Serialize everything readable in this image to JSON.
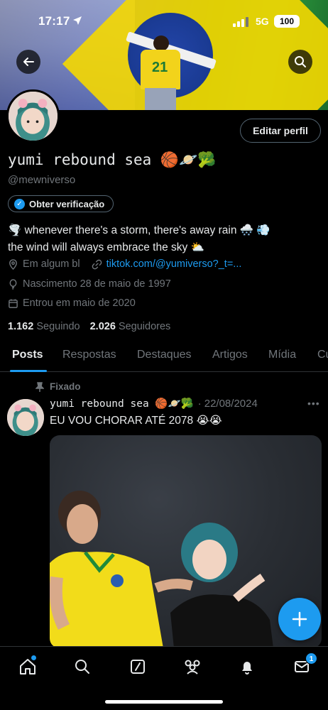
{
  "status_bar": {
    "time": "17:17",
    "network": "5G",
    "battery": "100"
  },
  "profile": {
    "name": "yumi rebound sea 🏀🪐🥦",
    "handle": "@mewniverso",
    "edit_label": "Editar perfil",
    "verify_label": "Obter verificação",
    "bio_line1": "🌪️ whenever there's a storm, there's away rain 🌨️ 💨",
    "bio_line2": "the wind will always embrace the sky ⛅",
    "location": "Em algum bl",
    "link": "tiktok.com/@yumiverso?_t=...",
    "birth": "Nascimento 28 de maio de 1997",
    "joined": "Entrou em maio de 2020",
    "following_count": "1.162",
    "following_label": "Seguindo",
    "followers_count": "2.026",
    "followers_label": "Seguidores"
  },
  "tabs": [
    "Posts",
    "Respostas",
    "Destaques",
    "Artigos",
    "Mídia",
    "Cu"
  ],
  "post": {
    "pinned_label": "Fixado",
    "author": "yumi rebound sea 🏀🪐🥦",
    "date": "· 22/08/2024",
    "text": "EU VOU CHORAR ATÉ 2078 😭😭"
  },
  "banner": {
    "shirt_number": "21"
  },
  "nav": {
    "notification_count": "1"
  },
  "colors": {
    "accent": "#1d9bf0",
    "background": "#000000",
    "muted": "#71767b"
  }
}
